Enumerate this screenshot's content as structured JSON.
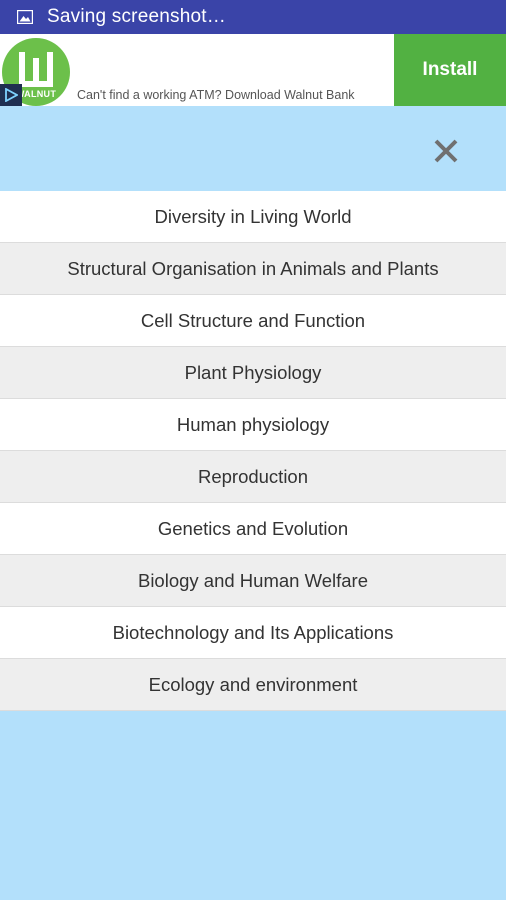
{
  "status_bar": {
    "text": "Saving screenshot…",
    "icon": "image-icon"
  },
  "ad": {
    "logo_text": "WALNUT",
    "text": "Can't find a working ATM? Download Walnut Bank",
    "install_label": "Install",
    "colors": {
      "logo": "#6cc04a",
      "install": "#52b142"
    }
  },
  "header": {
    "close_icon": "close-icon"
  },
  "chapters": [
    {
      "label": "Diversity in Living World"
    },
    {
      "label": "Structural Organisation in Animals and Plants"
    },
    {
      "label": "Cell Structure and Function"
    },
    {
      "label": "Plant Physiology"
    },
    {
      "label": "Human physiology"
    },
    {
      "label": "Reproduction"
    },
    {
      "label": "Genetics and Evolution"
    },
    {
      "label": "Biology and Human Welfare"
    },
    {
      "label": "Biotechnology and Its Applications"
    },
    {
      "label": "Ecology and environment"
    }
  ],
  "colors": {
    "status_bar": "#3a44a8",
    "background": "#b3e0fb",
    "row_alt": "#eeeeee"
  }
}
